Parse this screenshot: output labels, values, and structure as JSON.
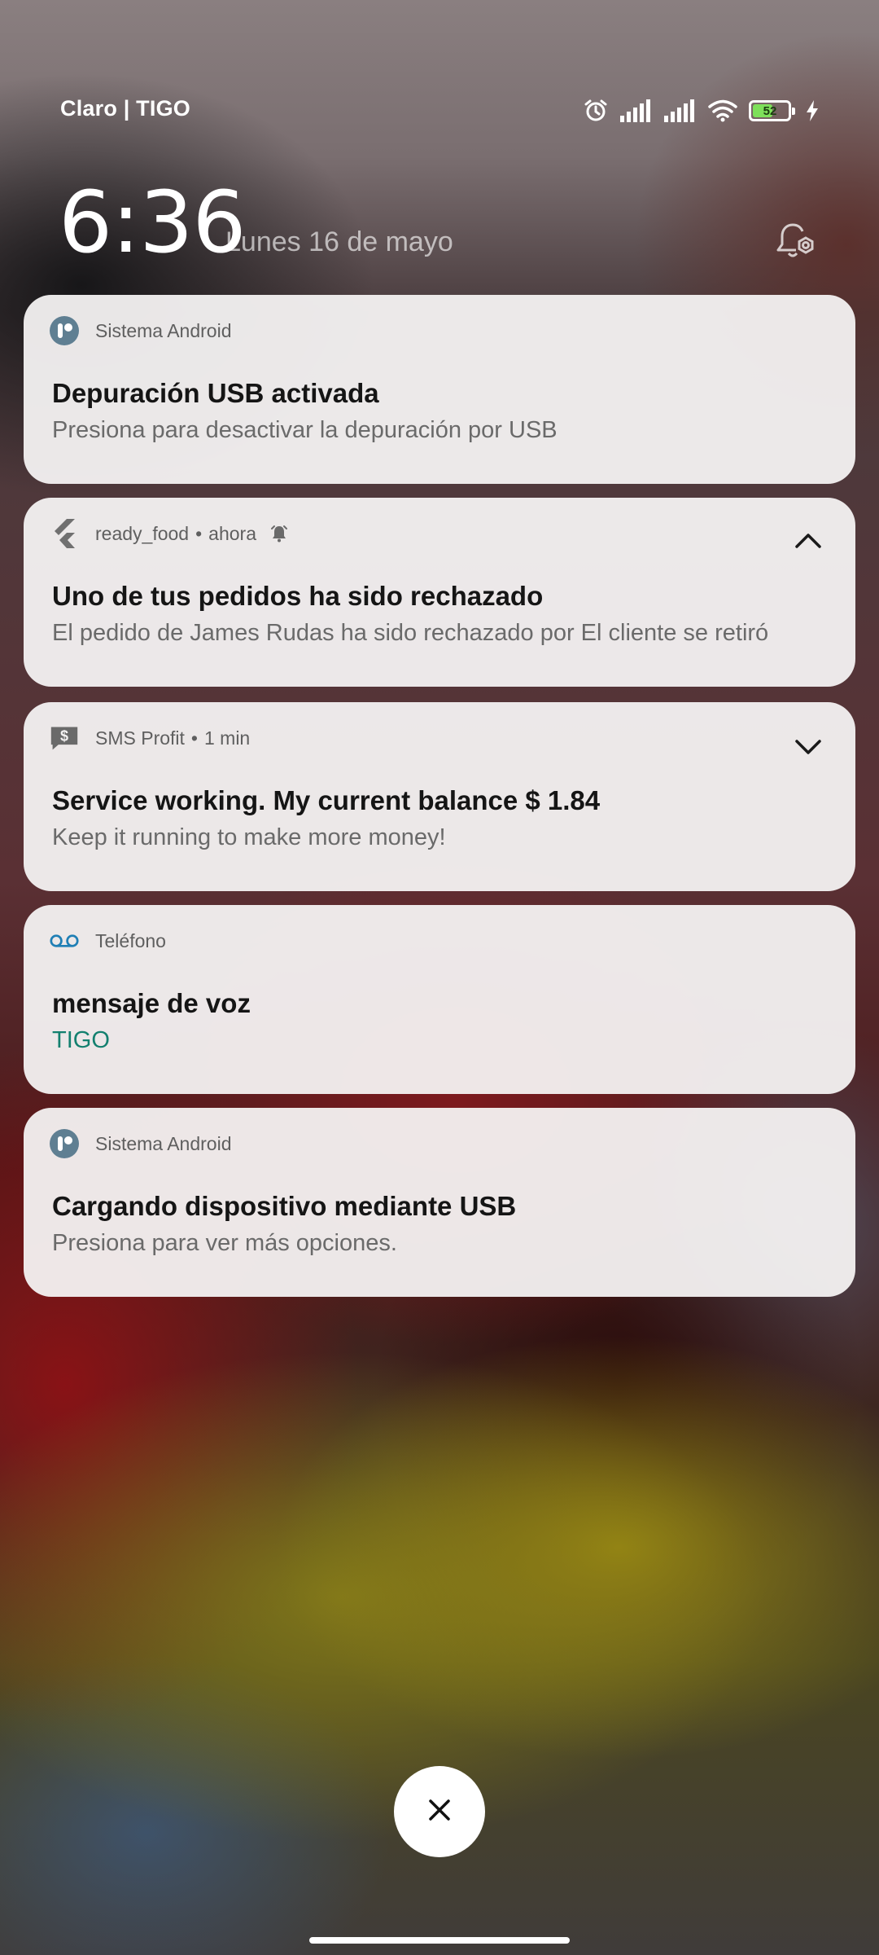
{
  "status_bar": {
    "carrier": "Claro | TIGO",
    "battery_level": "52",
    "battery_fraction": 0.52,
    "icons": [
      "alarm-icon",
      "signal-icon",
      "signal-icon",
      "wifi-icon",
      "battery-icon",
      "charging-icon"
    ]
  },
  "header": {
    "time": "6:36",
    "date": "Lunes 16 de mayo",
    "settings_icon": "notification-settings-icon"
  },
  "notifications": [
    {
      "app": "Sistema Android",
      "icon": "android-system-icon",
      "title": "Depuración USB activada",
      "body": "Presiona para desactivar la depuración por USB"
    },
    {
      "app": "ready_food",
      "icon": "flutter-icon",
      "dot": "•",
      "time": "ahora",
      "bell_icon": "bell-icon",
      "chevron": "chevron-up-icon",
      "title": "Uno de tus pedidos ha sido rechazado",
      "body": "El pedido de James Rudas  ha sido rechazado por El cliente se retiró"
    },
    {
      "app": "SMS Profit",
      "icon": "sms-dollar-icon",
      "dot": "•",
      "time": "1 min",
      "chevron": "chevron-down-icon",
      "title": "Service working. My current balance $ 1.84",
      "body": "Keep it running to make more money!"
    },
    {
      "app": "Teléfono",
      "icon": "voicemail-icon",
      "title": "mensaje de voz",
      "body": "TIGO"
    },
    {
      "app": "Sistema Android",
      "icon": "android-system-icon",
      "title": "Cargando dispositivo mediante USB",
      "body": "Presiona para ver más opciones."
    }
  ],
  "colors": {
    "card_bg": "#f4f2f2",
    "title": "#151515",
    "body": "#6a6a6a",
    "voicemail_accent": "#13806f",
    "android_icon": "#5f7f92"
  },
  "dismiss_icon": "close-icon"
}
